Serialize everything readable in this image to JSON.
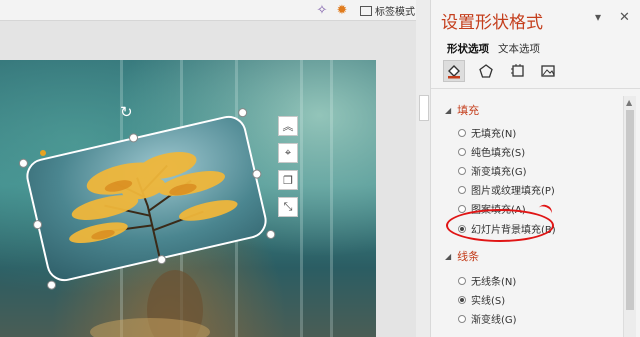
{
  "topbar": {
    "icon1": "sparkle-icon",
    "icon2": "gear-icon",
    "mode_label": "标签模式"
  },
  "pane": {
    "title": "设置形状格式",
    "tabs": [
      {
        "label": "形状选项",
        "active": true
      },
      {
        "label": "文本选项",
        "active": false
      }
    ],
    "icon_tabs": [
      "fill-line-icon",
      "pentagon-effects-icon",
      "size-properties-icon",
      "picture-icon"
    ],
    "fill_section": {
      "title": "填充",
      "options": [
        {
          "label": "无填充(N)",
          "selected": false
        },
        {
          "label": "纯色填充(S)",
          "selected": false
        },
        {
          "label": "渐变填充(G)",
          "selected": false
        },
        {
          "label": "图片或纹理填充(P)",
          "selected": false
        },
        {
          "label": "图案填充(A)",
          "selected": false
        },
        {
          "label": "幻灯片背景填充(B)",
          "selected": true
        }
      ]
    },
    "line_section": {
      "title": "线条",
      "options": [
        {
          "label": "无线条(N)",
          "selected": false
        },
        {
          "label": "实线(S)",
          "selected": true
        },
        {
          "label": "渐变线(G)",
          "selected": false
        }
      ]
    }
  },
  "colors": {
    "accent": "#c43e1c",
    "annotation": "#e01515"
  }
}
